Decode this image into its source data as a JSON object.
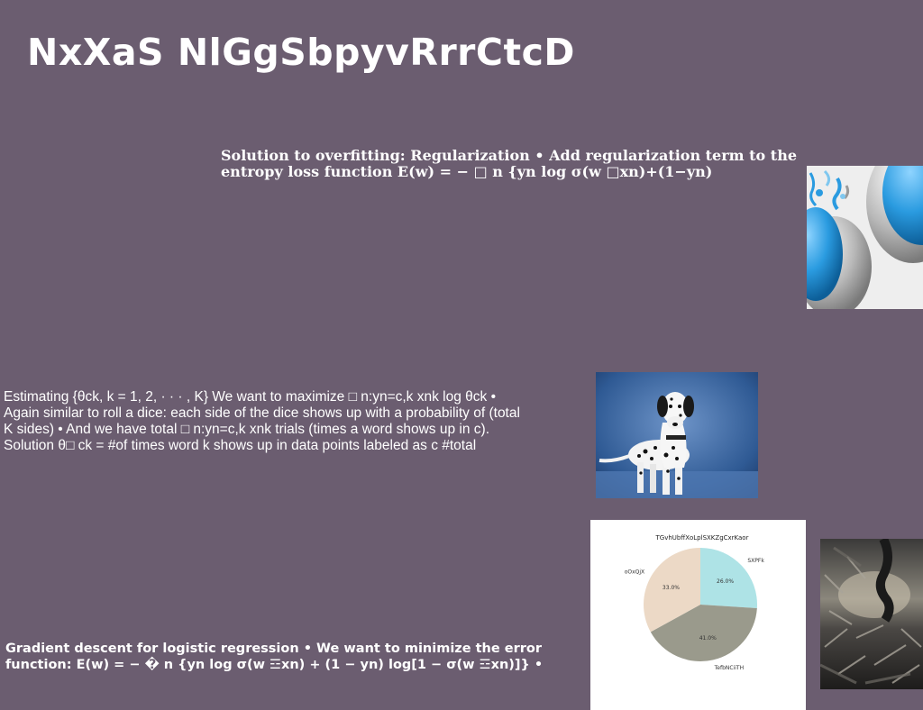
{
  "slide": {
    "title": "NxXaS NlGgSbpyvRrrCtcD",
    "paragraphs": {
      "regularization": "Solution to overfitting: Regularization • Add regularization term to the entropy loss function E(w) = − □ n {yn log σ(w □xn)+(1−yn)",
      "estimating": "Estimating {θck, k = 1, 2, · · · , K} We want to maximize □ n:yn=c,k xnk log θck • Again similar to roll a dice: each side of the dice shows up with a probability of (total K sides) • And we have total □ n:yn=c,k xnk trials (times a word shows up in c). Solution θ□ ck = #of times word k shows up in data points labeled as c #total",
      "gradient": "Gradient descent for logistic regression • We want to minimize the error function: E(w) = − � n {yn log σ(w ☲xn) + (1 − yn) log[1 − σ(w ☲xn)]} •"
    }
  },
  "images": {
    "balloons": "balloons-photo",
    "dalmatian": "dalmatian-photo",
    "dark": "dark-abstract-photo"
  },
  "colors": {
    "background": "#6b5d70",
    "text": "#ffffff",
    "pie_cyan": "#aee3e6",
    "pie_gray": "#9a9a8c",
    "pie_beige": "#ecd9c6"
  },
  "chart_data": {
    "type": "pie",
    "title": "TGvhUbffXoLplSXKZgCxrKaor",
    "slices": [
      {
        "label": "SXPFk",
        "value": 26.0,
        "pct_label": "26.0%",
        "color": "#aee3e6"
      },
      {
        "label": "TefbNCiiTH",
        "value": 41.0,
        "pct_label": "41.0%",
        "color": "#9a9a8c"
      },
      {
        "label": "oOxQjX",
        "value": 33.0,
        "pct_label": "33.0%",
        "color": "#ecd9c6"
      }
    ],
    "start": "top",
    "direction": "clockwise",
    "legend": "none"
  }
}
